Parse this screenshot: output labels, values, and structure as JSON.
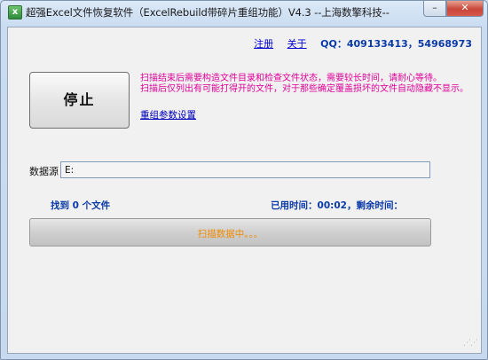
{
  "window": {
    "title": "超强Excel文件恢复软件（ExcelRebuild带碎片重组功能）V4.3  --上海数擎科技--",
    "minimize_label": "–",
    "close_label": "✕"
  },
  "header": {
    "register_label": "注册",
    "about_label": "关于",
    "qq_text": "QQ：409133413，54968973"
  },
  "actions": {
    "stop_label": "停止",
    "info_line1": "扫描结束后需要构造文件目录和检查文件状态，需要较长时间，请耐心等待。",
    "info_line2": "扫描后仅列出有可能打得开的文件，对于那些确定覆盖损坏的文件自动隐藏不显示。",
    "reset_params_label": "重组参数设置"
  },
  "source": {
    "label": "数据源",
    "value": "E:"
  },
  "status": {
    "found_text": "找到 0 个文件",
    "elapsed_text": "已用时间：00:02，剩余时间："
  },
  "progress": {
    "text": "扫描数据中。。。",
    "fraction": 0
  },
  "colors": {
    "info_text": "#e0009a",
    "link": "#0000cc",
    "status_text": "#0a3aa8",
    "progress_text": "#f08a00"
  }
}
